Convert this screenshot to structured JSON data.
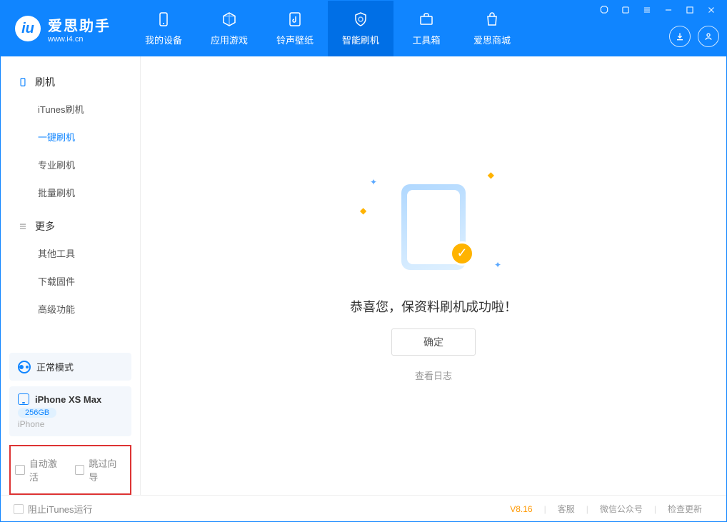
{
  "app": {
    "title": "爱思助手",
    "subtitle": "www.i4.cn"
  },
  "nav": [
    {
      "label": "我的设备"
    },
    {
      "label": "应用游戏"
    },
    {
      "label": "铃声壁纸"
    },
    {
      "label": "智能刷机"
    },
    {
      "label": "工具箱"
    },
    {
      "label": "爱思商城"
    }
  ],
  "sidebar": {
    "section1": {
      "title": "刷机",
      "items": [
        "iTunes刷机",
        "一键刷机",
        "专业刷机",
        "批量刷机"
      ]
    },
    "section2": {
      "title": "更多",
      "items": [
        "其他工具",
        "下载固件",
        "高级功能"
      ]
    }
  },
  "mode": {
    "label": "正常模式"
  },
  "device": {
    "name": "iPhone XS Max",
    "storage": "256GB",
    "type": "iPhone"
  },
  "checkboxes": {
    "auto_activate": "自动激活",
    "skip_guide": "跳过向导"
  },
  "main": {
    "success": "恭喜您，保资料刷机成功啦！",
    "ok": "确定",
    "view_log": "查看日志"
  },
  "footer": {
    "block_itunes": "阻止iTunes运行",
    "version": "V8.16",
    "links": [
      "客服",
      "微信公众号",
      "检查更新"
    ]
  },
  "icons": {
    "device": "phone-icon",
    "apps": "cube-icon",
    "ringtone": "music-file-icon",
    "flash": "shield-icon",
    "toolbox": "briefcase-icon",
    "store": "bag-icon",
    "download": "download-icon",
    "user": "user-icon"
  }
}
